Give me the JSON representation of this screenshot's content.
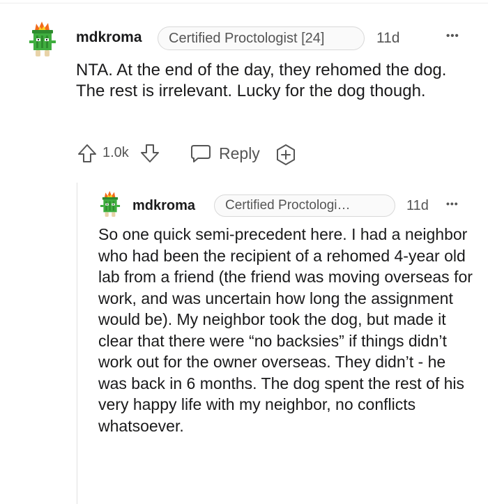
{
  "comment": {
    "username": "mdkroma",
    "flair": "Certified Proctologist [24]",
    "age": "11d",
    "more": "•••",
    "body": "NTA. At the end of the day, they rehomed the dog. The rest is irrelevant. Lucky for the dog though.",
    "vote_count": "1.0k",
    "reply_label": "Reply"
  },
  "reply": {
    "username": "mdkroma",
    "flair": "Certified Proctologi…",
    "age": "11d",
    "more": "•••",
    "body": "So one quick semi-precedent here. I had a neighbor who had been the recipient of a rehomed 4-year old lab from a friend (the friend was moving overseas for work, and was uncertain how long the assignment would be). My neighbor took the dog, but made it clear that there were “no backsies” if things didn’t work out for the owner overseas. They didn’t - he was back in 6 months. The dog spent the rest of his very happy life with my neighbor, no conflicts whatsoever."
  },
  "icons": [
    "avatar",
    "ellipsis-icon",
    "upvote-icon",
    "downvote-icon",
    "reply-icon",
    "award-icon"
  ],
  "colors": {
    "text": "#1a1a1b",
    "muted": "#555555",
    "border": "#d8d8d8",
    "avatar_green": "#3fae3f",
    "avatar_flame": "#f26a1b"
  }
}
